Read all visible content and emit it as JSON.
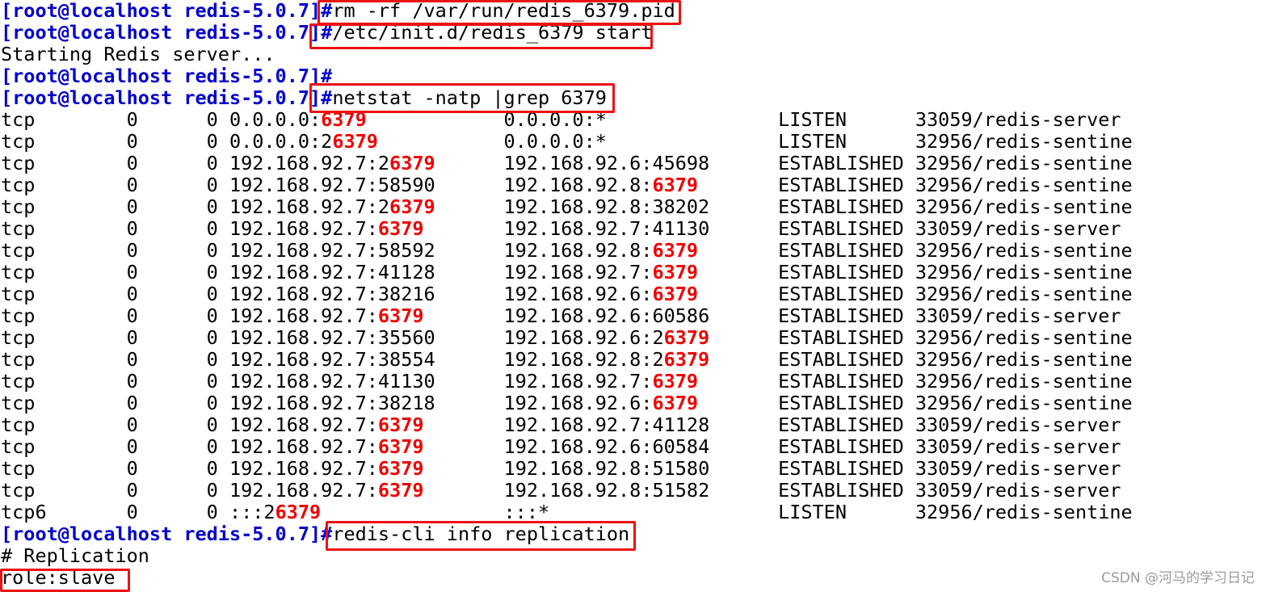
{
  "prompt": "[root@localhost redis-5.0.7]#",
  "highlight_port": "6379",
  "colors": {
    "prompt": "#0000cc",
    "highlight": "#ee0000",
    "box": "#ee1111"
  },
  "commands": [
    "rm -rf /var/run/redis_6379.pid",
    "/etc/init.d/redis_6379 start",
    "",
    "netstat -natp |grep 6379",
    "redis-cli info replication"
  ],
  "starting_message": "Starting Redis server...",
  "netstat_rows": [
    [
      "tcp",
      "0",
      "0",
      "0.0.0.0:6379",
      "0.0.0.0:*",
      "LISTEN",
      "33059/redis-server"
    ],
    [
      "tcp",
      "0",
      "0",
      "0.0.0.0:26379",
      "0.0.0.0:*",
      "LISTEN",
      "32956/redis-sentine"
    ],
    [
      "tcp",
      "0",
      "0",
      "192.168.92.7:26379",
      "192.168.92.6:45698",
      "ESTABLISHED",
      "32956/redis-sentine"
    ],
    [
      "tcp",
      "0",
      "0",
      "192.168.92.7:58590",
      "192.168.92.8:6379",
      "ESTABLISHED",
      "32956/redis-sentine"
    ],
    [
      "tcp",
      "0",
      "0",
      "192.168.92.7:26379",
      "192.168.92.8:38202",
      "ESTABLISHED",
      "32956/redis-sentine"
    ],
    [
      "tcp",
      "0",
      "0",
      "192.168.92.7:6379",
      "192.168.92.7:41130",
      "ESTABLISHED",
      "33059/redis-server"
    ],
    [
      "tcp",
      "0",
      "0",
      "192.168.92.7:58592",
      "192.168.92.8:6379",
      "ESTABLISHED",
      "32956/redis-sentine"
    ],
    [
      "tcp",
      "0",
      "0",
      "192.168.92.7:41128",
      "192.168.92.7:6379",
      "ESTABLISHED",
      "32956/redis-sentine"
    ],
    [
      "tcp",
      "0",
      "0",
      "192.168.92.7:38216",
      "192.168.92.6:6379",
      "ESTABLISHED",
      "32956/redis-sentine"
    ],
    [
      "tcp",
      "0",
      "0",
      "192.168.92.7:6379",
      "192.168.92.6:60586",
      "ESTABLISHED",
      "33059/redis-server"
    ],
    [
      "tcp",
      "0",
      "0",
      "192.168.92.7:35560",
      "192.168.92.6:26379",
      "ESTABLISHED",
      "32956/redis-sentine"
    ],
    [
      "tcp",
      "0",
      "0",
      "192.168.92.7:38554",
      "192.168.92.8:26379",
      "ESTABLISHED",
      "32956/redis-sentine"
    ],
    [
      "tcp",
      "0",
      "0",
      "192.168.92.7:41130",
      "192.168.92.7:6379",
      "ESTABLISHED",
      "32956/redis-sentine"
    ],
    [
      "tcp",
      "0",
      "0",
      "192.168.92.7:38218",
      "192.168.92.6:6379",
      "ESTABLISHED",
      "32956/redis-sentine"
    ],
    [
      "tcp",
      "0",
      "0",
      "192.168.92.7:6379",
      "192.168.92.7:41128",
      "ESTABLISHED",
      "33059/redis-server"
    ],
    [
      "tcp",
      "0",
      "0",
      "192.168.92.7:6379",
      "192.168.92.6:60584",
      "ESTABLISHED",
      "33059/redis-server"
    ],
    [
      "tcp",
      "0",
      "0",
      "192.168.92.7:6379",
      "192.168.92.8:51580",
      "ESTABLISHED",
      "33059/redis-server"
    ],
    [
      "tcp",
      "0",
      "0",
      "192.168.92.7:6379",
      "192.168.92.8:51582",
      "ESTABLISHED",
      "33059/redis-server"
    ],
    [
      "tcp6",
      "0",
      "0",
      ":::26379",
      ":::*",
      "LISTEN",
      "32956/redis-sentine"
    ]
  ],
  "replication_header": "# Replication",
  "role_line": "role:slave",
  "watermark": "CSDN @河马的学习日记"
}
